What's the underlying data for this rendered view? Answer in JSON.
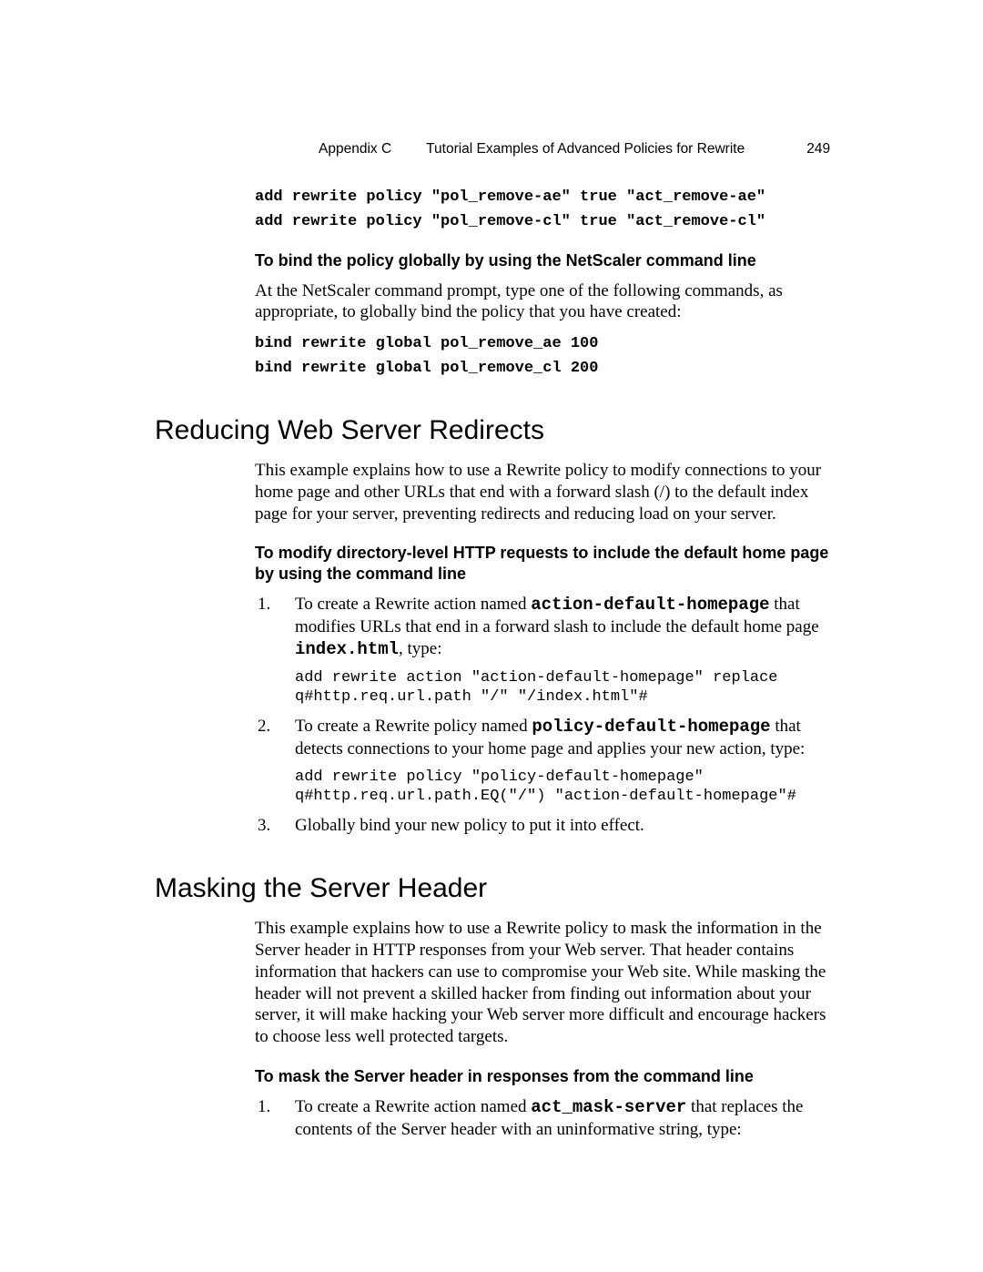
{
  "header": {
    "appendix": "Appendix  C",
    "title": "Tutorial Examples of Advanced Policies for Rewrite",
    "page": "249"
  },
  "intro": {
    "code1": "add rewrite policy \"pol_remove-ae\" true \"act_remove-ae\"",
    "code2": "add rewrite policy \"pol_remove-cl\" true \"act_remove-cl\"",
    "bind_heading": "To bind the policy globally by using the NetScaler command line",
    "bind_para": "At the NetScaler command prompt, type one of the following commands, as appropriate, to globally bind the policy that you have created:",
    "bind_code1": "bind rewrite global pol_remove_ae 100",
    "bind_code2": "bind rewrite global pol_remove_cl 200"
  },
  "reducing": {
    "title": "Reducing Web Server Redirects",
    "intro": "This example explains how to use a Rewrite policy to modify connections to your home page and other URLs that end with a forward slash (/) to the default index page for your server, preventing redirects and reducing load on your server.",
    "subhead": "To modify directory-level HTTP requests to include the default home page by using the command line",
    "steps": [
      {
        "pre1": "To create a Rewrite action named ",
        "mono1": "action-default-homepage",
        "post1": " that modifies URLs that end in a forward slash to include the default home page ",
        "mono2": "index.html",
        "post2": ", type:",
        "code": "add rewrite action \"action-default-homepage\" replace q#http.req.url.path \"/\" \"/index.html\"#"
      },
      {
        "pre1": "To create a Rewrite policy named ",
        "mono1": "policy-default-homepage",
        "post1": " that detects connections to your home page and applies your new action, type:",
        "code": "add rewrite policy \"policy-default-homepage\" q#http.req.url.path.EQ(\"/\") \"action-default-homepage\"#"
      },
      {
        "plain": "Globally bind your new policy to put it into effect."
      }
    ]
  },
  "masking": {
    "title": "Masking the Server Header",
    "intro": "This example explains how to use a Rewrite policy to mask the information in the Server header in HTTP responses from your Web server. That header contains information that hackers can use to compromise your Web site. While masking the header will not prevent a skilled hacker from finding out information about your server, it will make hacking your Web server more difficult and encourage hackers to choose less well protected targets.",
    "subhead": "To mask the Server header in responses from the command line",
    "steps": [
      {
        "pre1": "To create a Rewrite action named ",
        "mono1": "act_mask-server",
        "post1": " that replaces the contents of the Server header with an uninformative string, type:"
      }
    ]
  }
}
